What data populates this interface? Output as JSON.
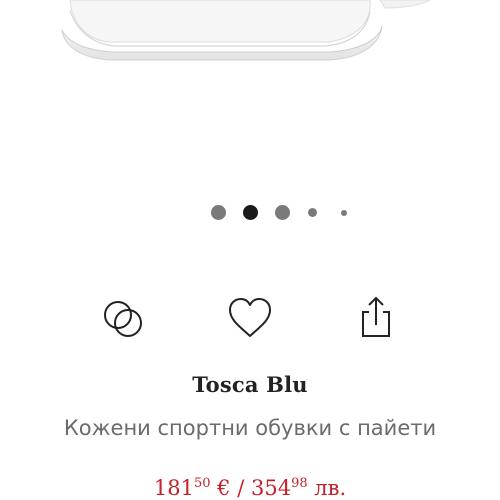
{
  "gallery": {
    "dot_count": 5,
    "active_index": 1
  },
  "actions": {
    "compare_icon": "rings-compare-icon",
    "favorite_icon": "heart-icon",
    "share_icon": "share-icon"
  },
  "product": {
    "brand": "Tosca Blu",
    "title": "Кожени спортни обувки с пайети",
    "price_eur_int": "181",
    "price_eur_dec": "50",
    "price_eur_currency": " € / ",
    "price_bgn_int": "354",
    "price_bgn_dec": "98",
    "price_bgn_currency": " лв."
  },
  "colors": {
    "price": "#c3212a",
    "brand": "#222222",
    "subtitle": "#6b6b6b",
    "dot": "#7a7a7a",
    "dot_active": "#1a1a1a"
  }
}
